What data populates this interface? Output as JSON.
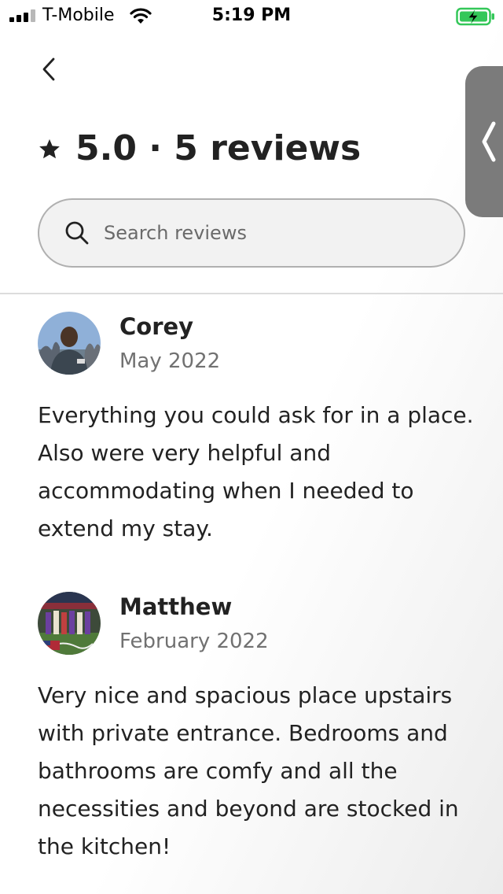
{
  "status_bar": {
    "carrier": "T-Mobile",
    "time": "5:19 PM",
    "signal_bars": 3,
    "battery_icon": "battery-charging-icon",
    "wifi_icon": "wifi-icon"
  },
  "header": {
    "back_icon": "chevron-left-icon",
    "rating_label": "5.0 · 5 reviews",
    "star_icon": "star-icon"
  },
  "search": {
    "placeholder": "Search reviews",
    "value": "",
    "icon": "search-icon"
  },
  "side_handle": {
    "icon": "chevron-left-icon"
  },
  "reviews": [
    {
      "name": "Corey",
      "date": "May 2022",
      "text": "Everything you could ask for in a place. Also were very helpful and accommodating when I needed to extend my stay."
    },
    {
      "name": "Matthew",
      "date": "February 2022",
      "text": "Very nice and spacious place upstairs with private entrance. Bedrooms and bathrooms are comfy and all the necessities and beyond are stocked in the kitchen!"
    }
  ],
  "colors": {
    "text_primary": "#222222",
    "text_secondary": "#717171",
    "battery_green": "#34c759",
    "handle_gray": "#7b7b7b"
  }
}
